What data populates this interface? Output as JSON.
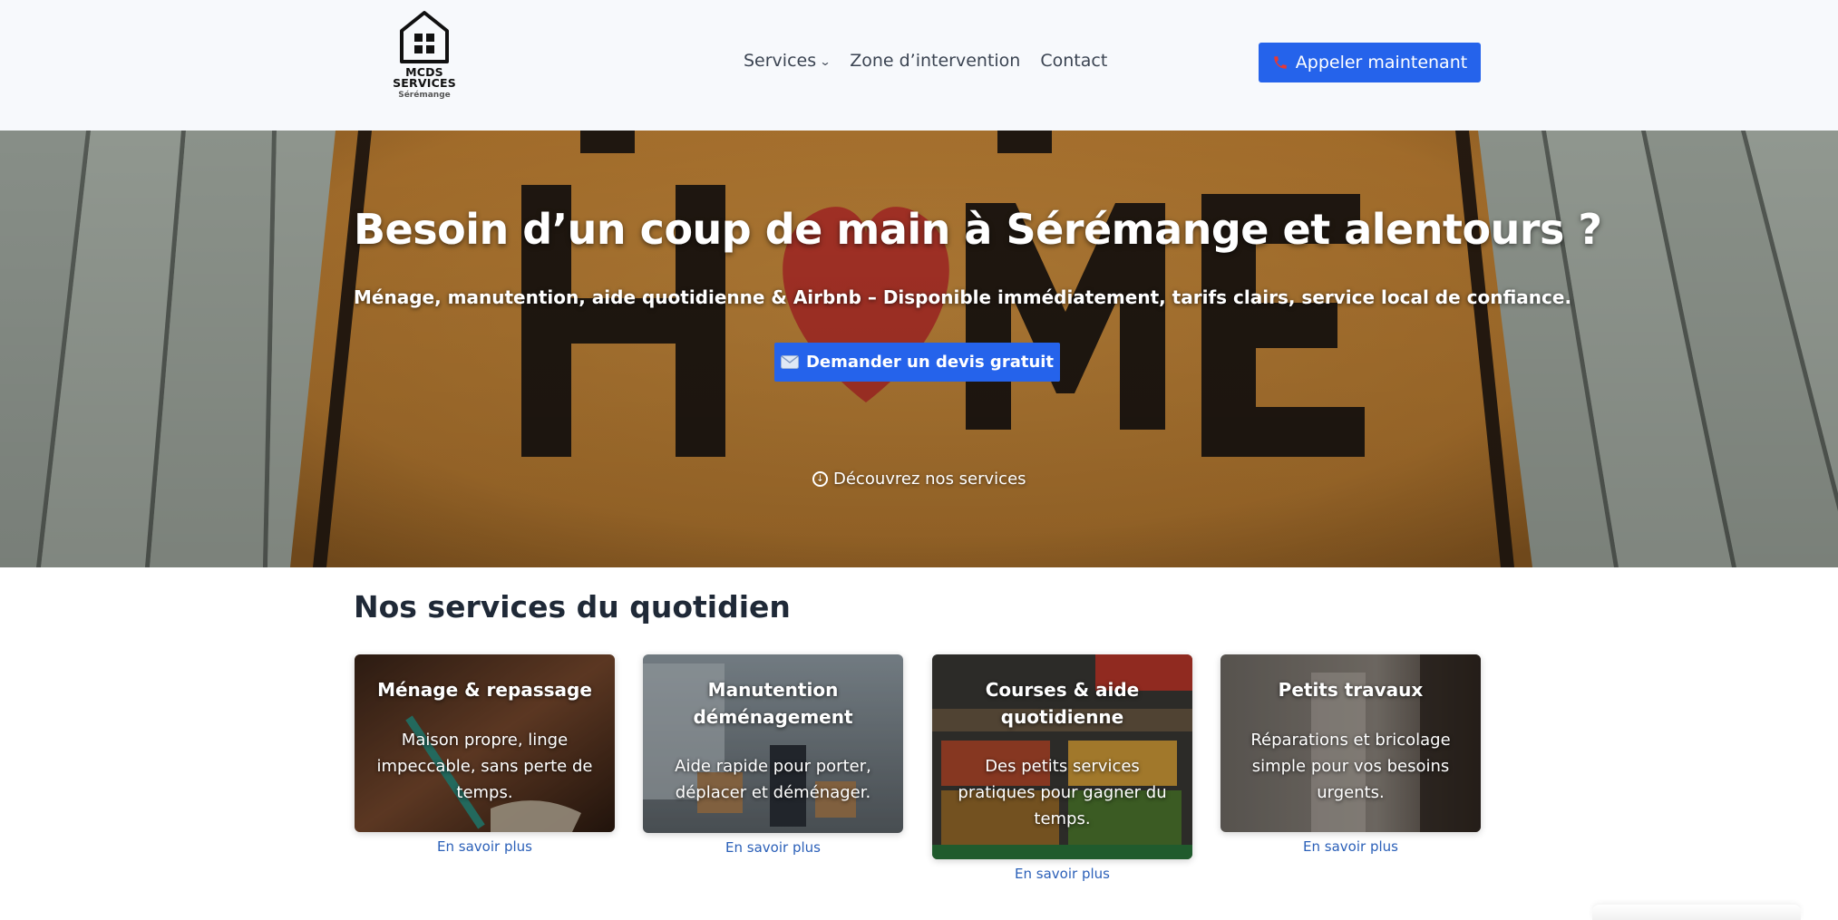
{
  "header": {
    "logo": {
      "name_line1": "MCDS",
      "name_line2": "SERVICES",
      "city": "Sérémange"
    },
    "nav": [
      {
        "label": "Services",
        "has_dropdown": true
      },
      {
        "label": "Zone d’intervention",
        "has_dropdown": false
      },
      {
        "label": "Contact",
        "has_dropdown": false
      }
    ],
    "call_button": {
      "icon": "phone-icon",
      "label": "Appeler maintenant"
    }
  },
  "hero": {
    "title": "Besoin d’un coup de main à Sérémange et alentours ?",
    "subtitle": "Ménage, manutention, aide quotidienne & Airbnb – Disponible immédiatement, tarifs clairs, service local de confiance.",
    "quote_button": {
      "icon": "envelope-icon",
      "label": "Demander un devis gratuit"
    },
    "discover": {
      "icon": "circle-arrow-down-icon",
      "label": "Découvrez nos services"
    }
  },
  "services": {
    "title": "Nos services du quotidien",
    "cards": [
      {
        "title": "Ménage & repassage",
        "description": "Maison propre, linge impeccable, sans perte de temps.",
        "link": "En savoir plus"
      },
      {
        "title": "Manutention déménagement",
        "description": "Aide rapide pour porter, déplacer et déménager.",
        "link": "En savoir plus"
      },
      {
        "title": "Courses & aide quotidienne",
        "description": "Des petits services pratiques pour gagner du temps.",
        "link": "En savoir plus"
      },
      {
        "title": "Petits travaux",
        "description": "Réparations et bricolage simple pour vos besoins urgents.",
        "link": "En savoir plus"
      }
    ]
  },
  "colors": {
    "accent": "#2563eb",
    "link": "#2a5fb8",
    "header_bg": "#f7f9fc",
    "heading": "#1f2937"
  }
}
